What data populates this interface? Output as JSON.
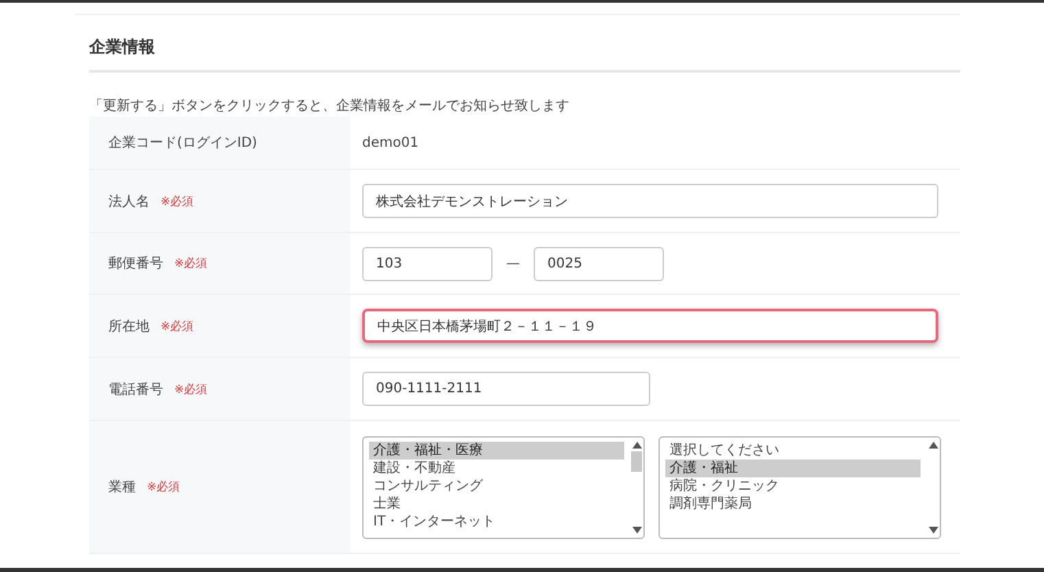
{
  "section": {
    "title": "企業情報",
    "note": "「更新する」ボタンをクリックすると、企業情報をメールでお知らせ致します"
  },
  "rows": [
    {
      "label": "企業コード(ログインID)",
      "kind": "static",
      "value": "demo01"
    },
    {
      "label": "法人名",
      "required_text": "※必須",
      "kind": "input",
      "highlighted": false,
      "value": "株式会社デモンストレーション"
    },
    {
      "label": "郵便番号",
      "required_text": "※必須",
      "kind": "postal",
      "parts": [
        "103",
        "0025"
      ],
      "separator": "—"
    },
    {
      "label": "所在地",
      "required_text": "※必須",
      "kind": "input",
      "highlighted": true,
      "value": "中央区日本橋茅場町２－１１－１９"
    },
    {
      "label": "電話番号",
      "required_text": "※必須",
      "kind": "short-input",
      "highlighted": false,
      "value": "090-1111-2111"
    },
    {
      "label": "業種",
      "required_text": "※必須",
      "kind": "lists",
      "lists": [
        {
          "options": [
            {
              "label": "介護・福祉・医療",
              "selected": true
            },
            {
              "label": "建設・不動産",
              "selected": false
            },
            {
              "label": "コンサルティング",
              "selected": false
            },
            {
              "label": "士業",
              "selected": false
            },
            {
              "label": "IT・インターネット",
              "selected": false
            }
          ]
        },
        {
          "options": [
            {
              "label": "選択してください",
              "selected": false
            },
            {
              "label": "介護・福祉",
              "selected": true
            },
            {
              "label": "病院・クリニック",
              "selected": false
            },
            {
              "label": "調剤専門薬局",
              "selected": false
            }
          ]
        }
      ]
    }
  ]
}
